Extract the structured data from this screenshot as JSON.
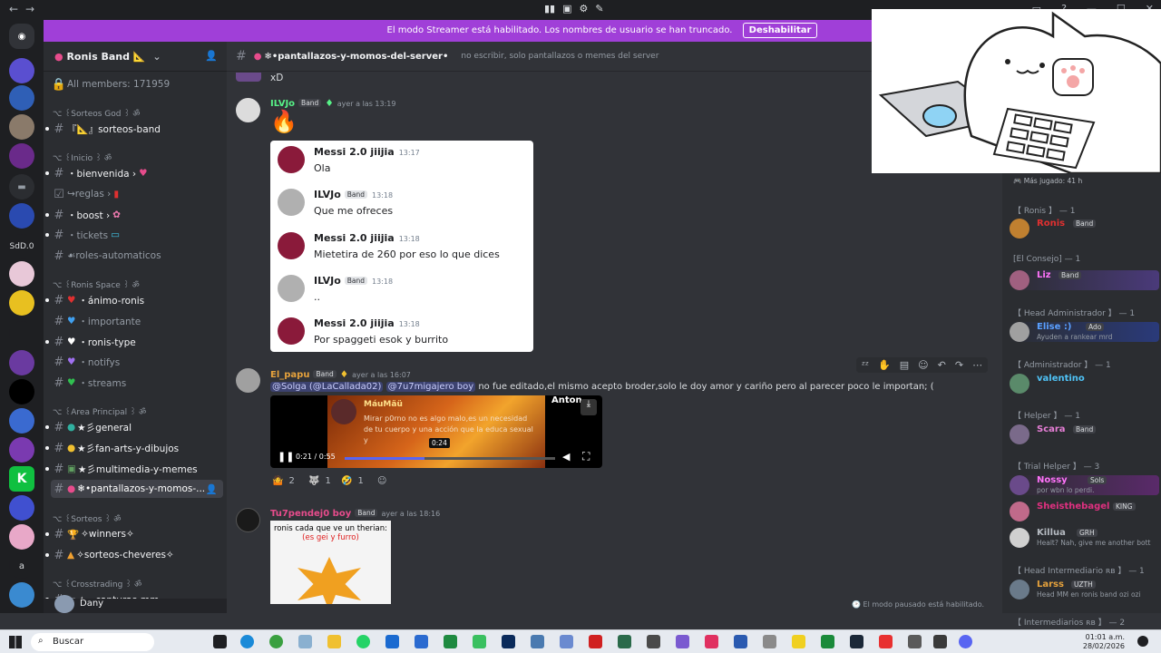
{
  "banner": {
    "text": "El modo Streamer está habilitado. Los nombres de usuario se han truncado.",
    "button": "Deshabilitar",
    "close": "✕"
  },
  "server": {
    "name": "Ronis Band 📐",
    "all_members": "All members: 171959"
  },
  "server_rail": {
    "label_sdd": "SdD.0",
    "label_a": "a"
  },
  "categories": {
    "sorteos_god": "⌥ ꒰Sorteos God ꒱ ॐ",
    "inicio": "⌥ ꒰Inicio ꒱ ॐ",
    "ronis_space": "⌥ ꒰Ronis Space ꒱ ॐ",
    "area_principal": "⌥ ꒰Area Principal ꒱ ॐ",
    "sorteos": "⌥ ꒰Sorteos ꒱ ॐ",
    "crosstrading": "⌥ ꒰Crosstrading ꒱ ॐ"
  },
  "channels": {
    "sorteos_band": "『📐』sorteos-band",
    "bienvenida": "・bienvenida ›",
    "reglas": "↪reglas ›",
    "boost": "・boost ›",
    "tickets": "・tickets",
    "roles": "☙roles-automaticos",
    "animo": "・ánimo-ronis",
    "importante": "・importante",
    "ronis_type": "・ronis-type",
    "notifys": "・notifys",
    "streams": "・streams",
    "general": "★彡general",
    "fanarts": "★彡fan-arts-y-dibujos",
    "multimedia": "★彡multimedia-y-memes",
    "pantallazos": "❄•pantallazos-y-momos-...",
    "winners": "✧winners✧",
    "sorteos_cheveres": "✧sorteos-cheveres✧",
    "capturas": "✦・capturas-mm"
  },
  "user": {
    "name": "Dany"
  },
  "header": {
    "channel": "❄•pantallazos-y-momos-del-server•",
    "topic": "no escribir, solo pantallazos o memes del server"
  },
  "messages": {
    "first_text": "xD",
    "m1": {
      "author": "ILVJo",
      "tag": "Band",
      "time": "ayer a las 13:19",
      "content": "🔥"
    },
    "embed": [
      {
        "author": "Messi 2.0 jiijia",
        "time": "13:17",
        "text": "Ola"
      },
      {
        "author": "ILVJo",
        "tag": "Band",
        "time": "13:18",
        "text": "Que me ofreces"
      },
      {
        "author": "Messi 2.0 jiijia",
        "time": "13:18",
        "text": "Mietetira de 260 por eso lo que dices"
      },
      {
        "author": "ILVJo",
        "tag": "Band",
        "time": "13:18",
        "text": ".."
      },
      {
        "author": "Messi 2.0 jiijia",
        "time": "13:18",
        "text": "Por spaggeti esok y burrito"
      }
    ],
    "m2": {
      "author": "El_papu",
      "tag": "Band",
      "time": "ayer a las 16:07",
      "mention1": "@Solga (@LaCallada02)",
      "mention2": "@7u7migajero boy",
      "text": " no fue editado,el mismo acepto broder,solo le doy amor y cariño pero al parecer poco le importan; ("
    },
    "video": {
      "title": "MáuMäü",
      "overlay": "Mirar p0rno no es algo malo,es un necesidad de tu cuerpo y una acción que la educa sexual y",
      "corner": "Anton",
      "time": "0:21 / 0:55",
      "tooltip": "0:24",
      "progress": 0.38
    },
    "reactions": [
      {
        "emoji": "🤷",
        "count": "2"
      },
      {
        "emoji": "🐺",
        "count": "1"
      },
      {
        "emoji": "🤣",
        "count": "1"
      }
    ],
    "m3": {
      "author": "Tu7pendej0 boy",
      "tag": "Band",
      "time": "ayer a las 18:16",
      "caption1": "ronis cada que ve un therian:",
      "caption2": "(es gei y furro)"
    }
  },
  "slowmode": "🕑 El modo pausado está habilitado.",
  "members": {
    "mas_jugado": "🎮 Más jugado: 41 h",
    "cats": {
      "ronis": "【 Ronis 】 — 1",
      "consejo": "[El Consejo] — 1",
      "head_admin": "【 Head Administrador 】 — 1",
      "admin": "【 Administrador 】 — 1",
      "helper": "【 Helper 】 — 1",
      "trial": "【 Trial Helper 】 — 3",
      "head_inter": "【 Head Intermediario ʀʙ 】 — 1",
      "inter": "【 Intermediarios ʀʙ 】 — 2"
    },
    "list": {
      "ronis": {
        "name": "Ronis",
        "tag": "Band"
      },
      "liz": {
        "name": "Liz",
        "tag": "Band"
      },
      "head_admin": {
        "name": "Elise :)",
        "tag": "Ado",
        "sub": "Ayuden a rankear mrd"
      },
      "valentino": {
        "name": "valentino"
      },
      "scara": {
        "name": "Scara",
        "tag": "Band"
      },
      "nossy": {
        "name": "Nossy",
        "tag": "Sols",
        "sub": "por wbn lo perdi."
      },
      "trial2": {
        "name": "Sheisthebagel..",
        "tag": "KING"
      },
      "killua": {
        "name": "Killua",
        "tag": "GRH",
        "sub": "Healt? Nah, give me another bott"
      },
      "larss": {
        "name": "Larss",
        "tag": "UZTH",
        "sub": "Head MM en ronis band ozi ozi"
      }
    }
  },
  "taskbar": {
    "search": "Buscar",
    "time": "01:01 a.m.",
    "date": "28/02/2026"
  },
  "colors": {
    "banner": "#a03fd8",
    "accent": "#5865f2",
    "bg": "#313338",
    "sidebar": "#2b2d31"
  }
}
